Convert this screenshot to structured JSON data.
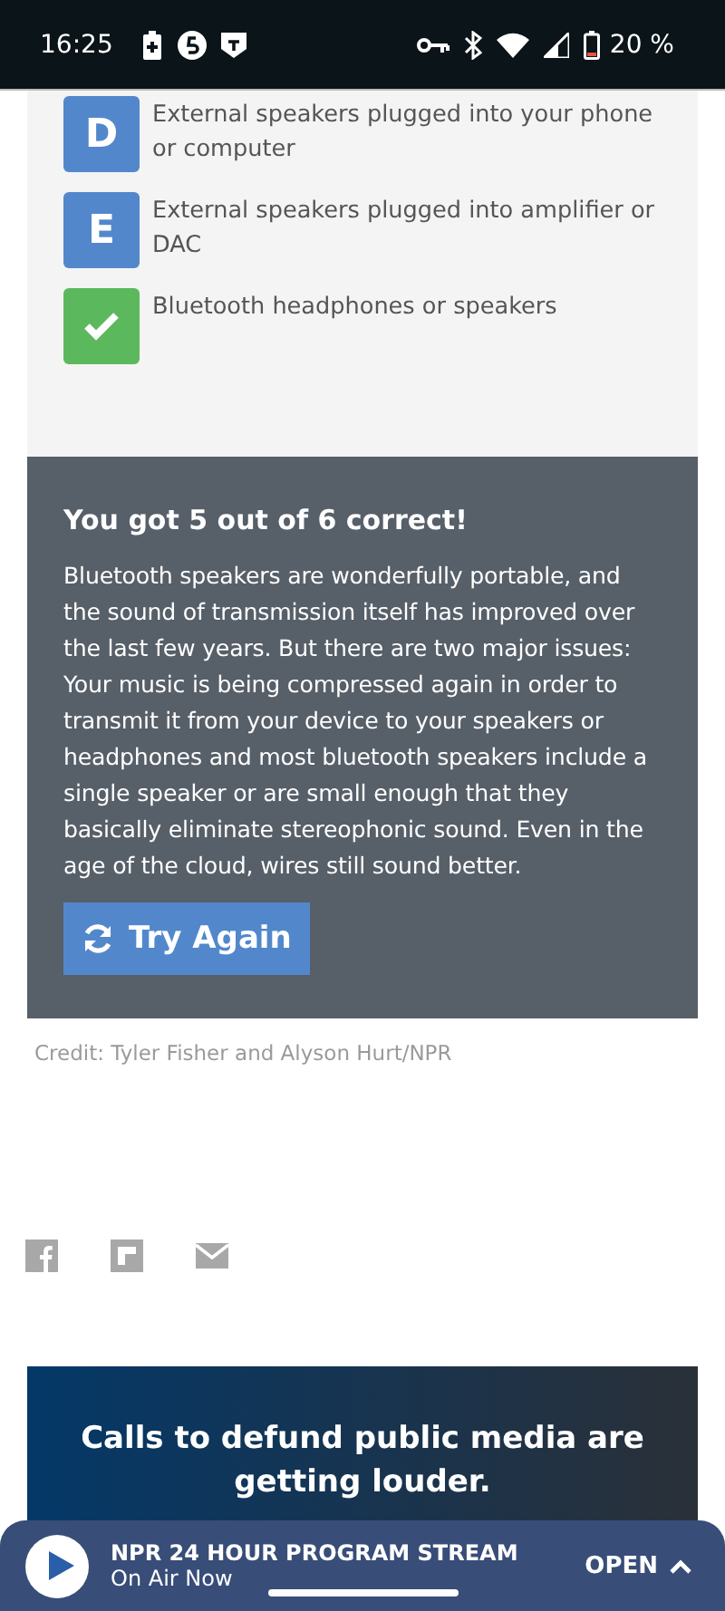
{
  "status_bar": {
    "time": "16:25",
    "battery": "20 %"
  },
  "options": [
    {
      "kind": "letter",
      "letter": "D",
      "text": "External speakers plugged into your phone or computer"
    },
    {
      "kind": "letter",
      "letter": "E",
      "text": "External speakers plugged into amplifier or DAC"
    },
    {
      "kind": "correct",
      "text": "Bluetooth headphones or speakers"
    }
  ],
  "result": {
    "title": "You got 5 out of 6 correct!",
    "body": "Bluetooth speakers are wonderfully portable, and the sound of transmission itself has improved over the last few years. But there are two major issues: Your music is being compressed again in order to transmit it from your device to your speakers or headphones and most bluetooth speakers include a single speaker or are small enough that they basically eliminate stereophonic sound. Even in the age of the cloud, wires still sound better.",
    "button": "Try Again"
  },
  "credit": "Credit: Tyler Fisher and Alyson Hurt/NPR",
  "banner": {
    "headline": "Calls to defund public media are getting louder."
  },
  "player": {
    "title": "NPR 24 HOUR PROGRAM STREAM",
    "subtitle": "On Air Now",
    "open": "OPEN"
  }
}
